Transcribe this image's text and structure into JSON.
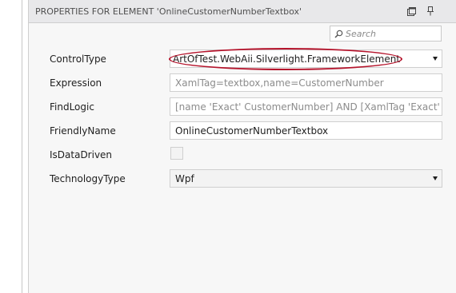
{
  "panel": {
    "title": "PROPERTIES FOR ELEMENT 'OnlineCustomerNumberTextbox'",
    "icons": [
      "restore-window-icon",
      "pin-icon"
    ]
  },
  "search": {
    "placeholder": "Search",
    "icon": "search-icon"
  },
  "properties": [
    {
      "label": "ControlType",
      "value": "ArtOfTest.WebAii.Silverlight.FrameworkElement",
      "kind": "dropdown"
    },
    {
      "label": "Expression",
      "value": "XamlTag=textbox,name=CustomerNumber",
      "kind": "readonly"
    },
    {
      "label": "FindLogic",
      "value": "[name 'Exact' CustomerNumber] AND [XamlTag 'Exact' textbo",
      "kind": "readonly"
    },
    {
      "label": "FriendlyName",
      "value": "OnlineCustomerNumberTextbox",
      "kind": "text"
    },
    {
      "label": "IsDataDriven",
      "value": false,
      "kind": "checkbox"
    },
    {
      "label": "TechnologyType",
      "value": "Wpf",
      "kind": "dropdown"
    }
  ],
  "highlight": {
    "color": "#b5132b",
    "target": "ControlType"
  }
}
